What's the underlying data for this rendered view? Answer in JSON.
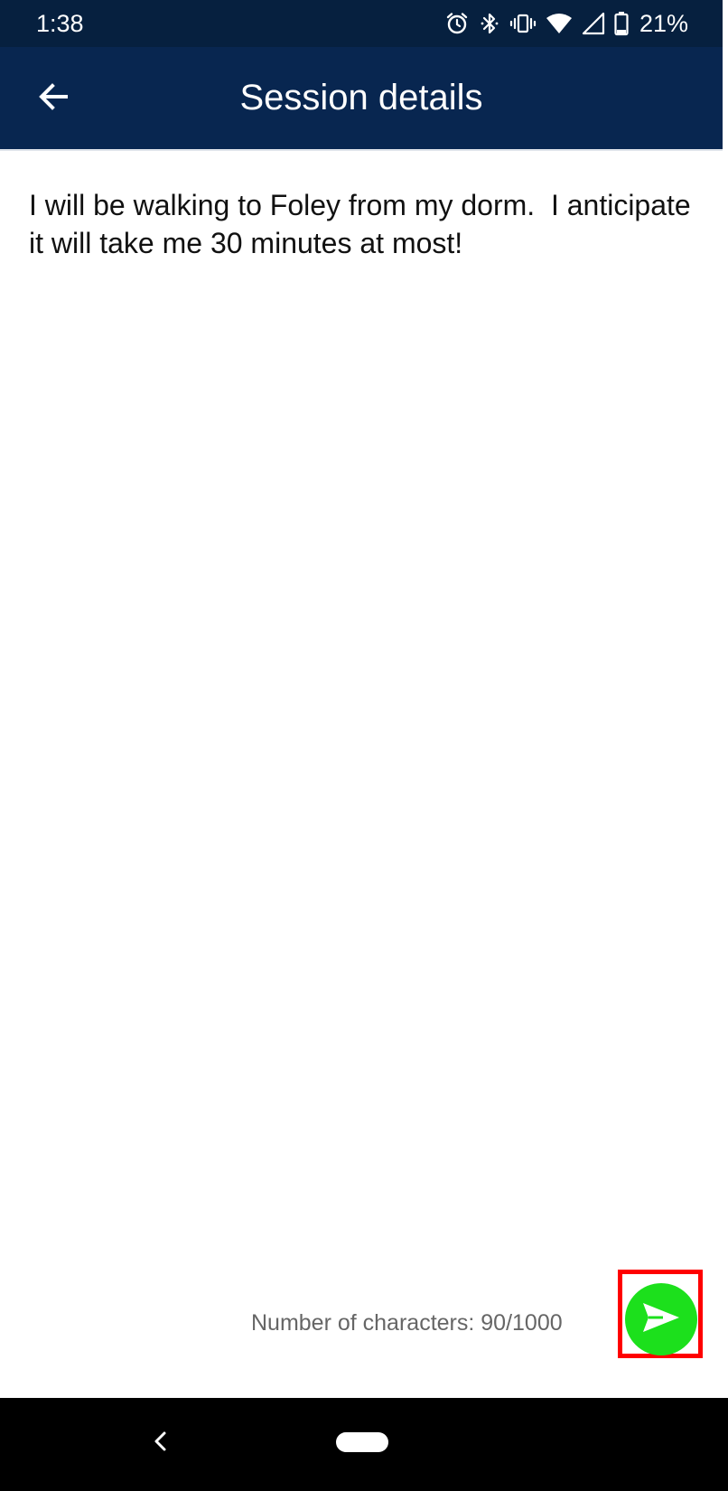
{
  "status_bar": {
    "time": "1:38",
    "battery": "21%",
    "icons": [
      "alarm-icon",
      "bluetooth-icon",
      "vibrate-icon",
      "wifi-icon",
      "cell-signal-icon",
      "battery-icon"
    ]
  },
  "app_bar": {
    "title": "Session details",
    "back_icon": "arrow-back-icon"
  },
  "content": {
    "details_text": "I will be walking to Foley from my dorm.  I anticipate it will take me 30 minutes at most!"
  },
  "footer": {
    "char_count": "Number of characters: 90/1000",
    "send_icon": "send-icon"
  },
  "colors": {
    "status_bar_bg": "#06203f",
    "app_bar_bg": "#082650",
    "send_button": "#1ce01c",
    "highlight_border": "#ff0000"
  },
  "nav_bar": {
    "icons": [
      "nav-back-icon",
      "nav-home-pill"
    ]
  }
}
